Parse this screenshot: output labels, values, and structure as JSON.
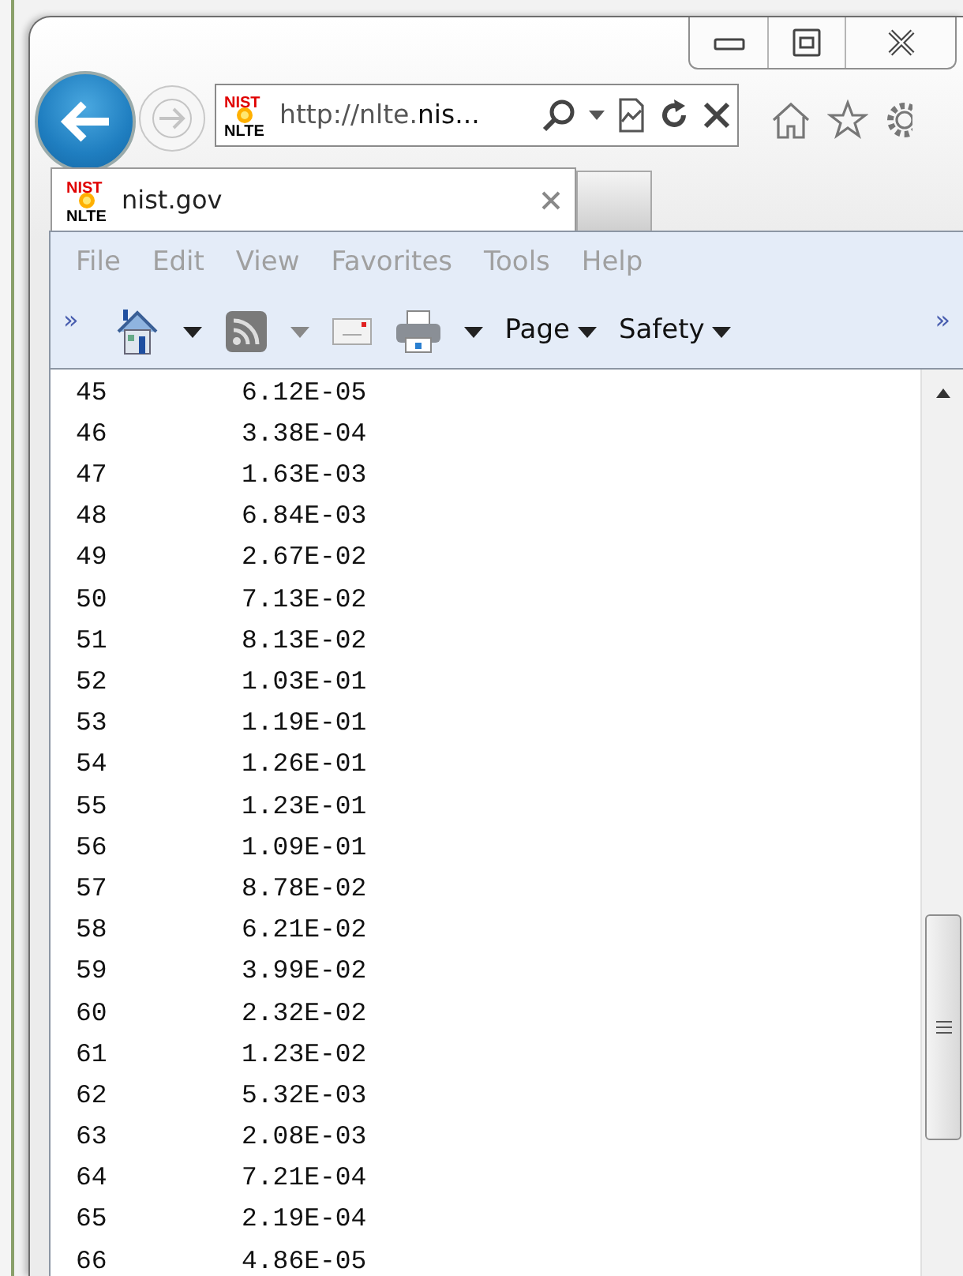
{
  "window": {
    "controls": [
      {
        "kind": "minimize"
      },
      {
        "kind": "maximize"
      },
      {
        "kind": "close"
      }
    ]
  },
  "address_bar": {
    "favicon": {
      "top": "NIST",
      "bottom": "NLTE"
    },
    "url_plain": "http://nlte.",
    "url_bold": "nis..."
  },
  "tabs": [
    {
      "favicon": {
        "top": "NIST",
        "bottom": "NLTE"
      },
      "label": "nist.gov",
      "selected": true
    }
  ],
  "menu": [
    "File",
    "Edit",
    "View",
    "Favorites",
    "Tools",
    "Help"
  ],
  "command_bar": {
    "chevron_left": "»",
    "chevron_right": "»",
    "page": "Page",
    "safety": "Safety"
  },
  "rows": [
    {
      "n": "45",
      "v": "6.12E-05"
    },
    {
      "n": "46",
      "v": "3.38E-04"
    },
    {
      "n": "47",
      "v": "1.63E-03"
    },
    {
      "n": "48",
      "v": "6.84E-03"
    },
    {
      "n": "49",
      "v": "2.67E-02"
    },
    {
      "n": "50",
      "v": "7.13E-02"
    },
    {
      "n": "51",
      "v": "8.13E-02"
    },
    {
      "n": "52",
      "v": "1.03E-01"
    },
    {
      "n": "53",
      "v": "1.19E-01"
    },
    {
      "n": "54",
      "v": "1.26E-01"
    },
    {
      "n": "55",
      "v": "1.23E-01"
    },
    {
      "n": "56",
      "v": "1.09E-01"
    },
    {
      "n": "57",
      "v": "8.78E-02"
    },
    {
      "n": "58",
      "v": "6.21E-02"
    },
    {
      "n": "59",
      "v": "3.99E-02"
    },
    {
      "n": "60",
      "v": "2.32E-02"
    },
    {
      "n": "61",
      "v": "1.23E-02"
    },
    {
      "n": "62",
      "v": "5.32E-03"
    },
    {
      "n": "63",
      "v": "2.08E-03"
    },
    {
      "n": "64",
      "v": "7.21E-04"
    },
    {
      "n": "65",
      "v": "2.19E-04"
    },
    {
      "n": "66",
      "v": "4.86E-05"
    }
  ]
}
